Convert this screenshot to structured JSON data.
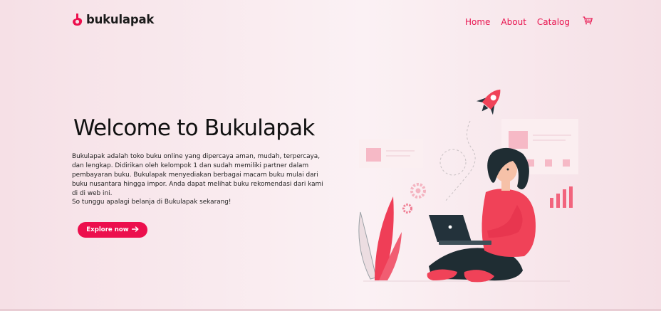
{
  "brand": {
    "name": "bukulapak",
    "logo_icon": "bukulapak-logo-icon"
  },
  "nav": {
    "items": [
      {
        "label": "Home"
      },
      {
        "label": "About"
      },
      {
        "label": "Catalog"
      }
    ],
    "cart_icon": "shopping-cart-icon"
  },
  "hero": {
    "title": "Welcome to Bukulapak",
    "description": "Bukulapak adalah toko buku online yang dipercaya aman, mudah, terpercaya, dan lengkap. Didirikan oleh kelompok 1 dan sudah memiliki partner dalam pembayaran buku. Bukulapak menyediakan berbagai macam buku mulai dari buku nusantara hingga impor. Anda dapat melihat buku rekomendasi dari kami di di web ini.",
    "cta_text": "So tunggu apalagi belanja di Bukulapak sekarang!",
    "button_label": "Explore now",
    "button_icon": "arrow-right-icon",
    "illustration": "woman-with-laptop-rocket-illustration"
  },
  "colors": {
    "accent": "#ec0f4d",
    "nav_link": "#e8144f",
    "background_left": "#f6e0e6",
    "background_center": "#fbf1f4",
    "text": "#111111",
    "illustration_dark": "#1f2d33",
    "illustration_pink": "#f2adbc"
  }
}
